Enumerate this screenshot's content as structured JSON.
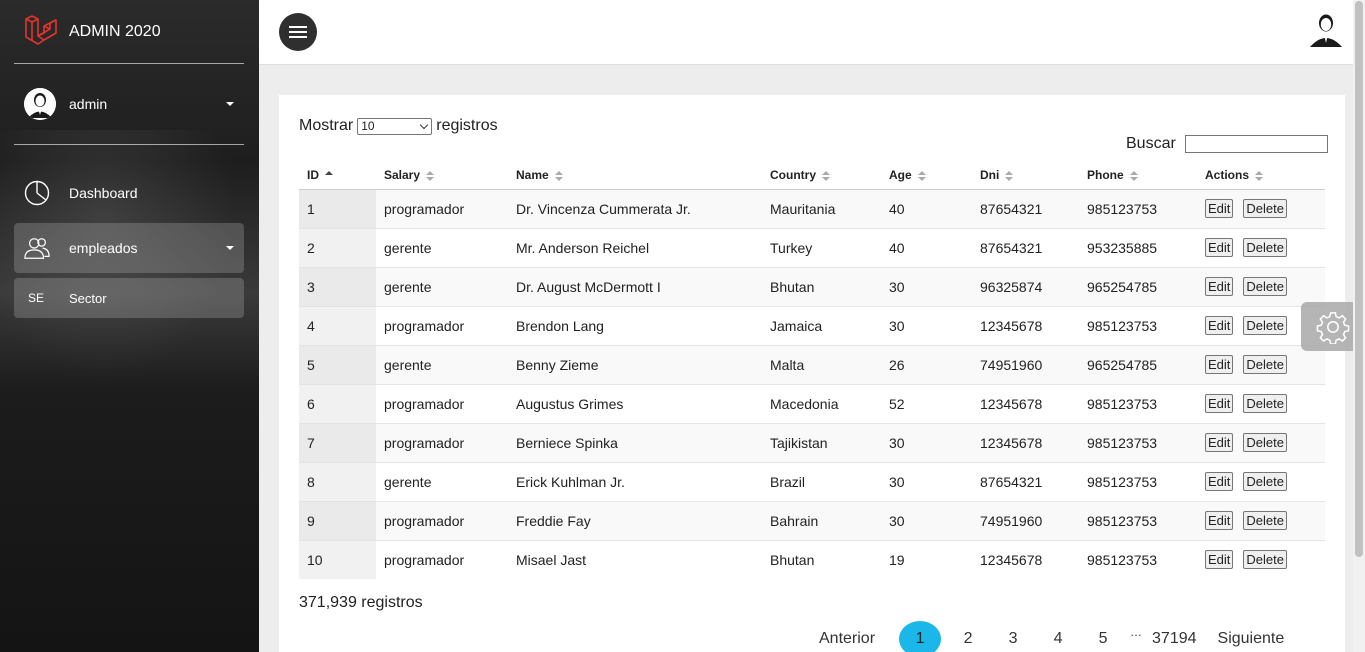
{
  "sidebar": {
    "brand": "ADMIN 2020",
    "user": "admin",
    "items": [
      {
        "label": "Dashboard",
        "icon": "pie-chart-icon"
      },
      {
        "label": "empleados",
        "icon": "users-icon"
      },
      {
        "abbr": "SE",
        "label": "Sector"
      }
    ]
  },
  "table_controls": {
    "show_label": "Mostrar",
    "length_value": "10",
    "records_label": "registros",
    "search_label": "Buscar",
    "search_value": ""
  },
  "table": {
    "headers": [
      "ID",
      "Salary",
      "Name",
      "Country",
      "Age",
      "Dni",
      "Phone",
      "Actions"
    ],
    "rows": [
      [
        "1",
        "programador",
        "Dr. Vincenza Cummerata Jr.",
        "Mauritania",
        "40",
        "87654321",
        "985123753"
      ],
      [
        "2",
        "gerente",
        "Mr. Anderson Reichel",
        "Turkey",
        "40",
        "87654321",
        "953235885"
      ],
      [
        "3",
        "gerente",
        "Dr. August McDermott I",
        "Bhutan",
        "30",
        "96325874",
        "965254785"
      ],
      [
        "4",
        "programador",
        "Brendon Lang",
        "Jamaica",
        "30",
        "12345678",
        "985123753"
      ],
      [
        "5",
        "gerente",
        "Benny Zieme",
        "Malta",
        "26",
        "74951960",
        "965254785"
      ],
      [
        "6",
        "programador",
        "Augustus Grimes",
        "Macedonia",
        "52",
        "12345678",
        "985123753"
      ],
      [
        "7",
        "programador",
        "Berniece Spinka",
        "Tajikistan",
        "30",
        "12345678",
        "985123753"
      ],
      [
        "8",
        "gerente",
        "Erick Kuhlman Jr.",
        "Brazil",
        "30",
        "87654321",
        "985123753"
      ],
      [
        "9",
        "programador",
        "Freddie Fay",
        "Bahrain",
        "30",
        "74951960",
        "985123753"
      ],
      [
        "10",
        "programador",
        "Misael Jast",
        "Bhutan",
        "19",
        "12345678",
        "985123753"
      ]
    ],
    "edit_label": "Edit",
    "delete_label": "Delete"
  },
  "info": "371,939 registros",
  "pagination": {
    "prev": "Anterior",
    "pages": [
      "1",
      "2",
      "3",
      "4",
      "5"
    ],
    "ellipsis": "…",
    "last": "37194",
    "next": "Siguiente",
    "current": "1"
  },
  "colors": {
    "accent": "#1bb7e8",
    "sidebar_bg": "#1e1e1e",
    "laravel_red": "#e3342f"
  }
}
